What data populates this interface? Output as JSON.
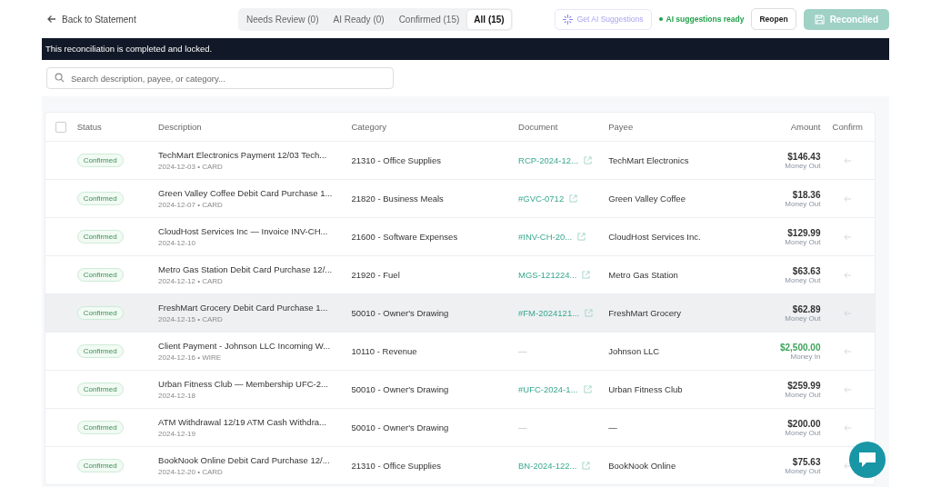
{
  "back_link": "Back to Statement",
  "tabs": [
    {
      "label": "Needs Review (0)",
      "selected": false
    },
    {
      "label": "AI Ready (0)",
      "selected": false
    },
    {
      "label": "Confirmed (15)",
      "selected": false
    },
    {
      "label": "All (15)",
      "selected": true
    }
  ],
  "ai_button": {
    "label": "Get AI Suggestions",
    "disabled": true
  },
  "ai_status": {
    "label": "AI suggestions ready",
    "color": "#22a04b"
  },
  "reopen_button": "Reopen",
  "reconciled_button": {
    "label": "Reconciled",
    "disabled": true
  },
  "banner": "This reconciliation is completed and locked.",
  "search": {
    "placeholder": "Search description, payee, or category..."
  },
  "table": {
    "select_all": {
      "checked": false
    },
    "columns": [
      "Status",
      "Description",
      "Category",
      "Document",
      "Payee",
      "Amount",
      "Confirm"
    ],
    "rows": [
      {
        "status": "Confirmed",
        "description": "TechMart Electronics Payment 12/03 Tech...",
        "meta": "2024-12-03 • CARD",
        "category": "21310 - Office Supplies",
        "document": "RCP-2024-12...",
        "document_linked": true,
        "payee": "TechMart Electronics",
        "amount": "$146.43",
        "direction": "Money Out",
        "kind": "out",
        "highlighted": false
      },
      {
        "status": "Confirmed",
        "description": "Green Valley Coffee Debit Card Purchase 1...",
        "meta": "2024-12-07 • CARD",
        "category": "21820 - Business Meals",
        "document": "#GVC-0712",
        "document_linked": true,
        "payee": "Green Valley Coffee",
        "amount": "$18.36",
        "direction": "Money Out",
        "kind": "out",
        "highlighted": false
      },
      {
        "status": "Confirmed",
        "description": "CloudHost Services Inc — Invoice INV-CH...",
        "meta": "2024-12-10",
        "category": "21600 - Software Expenses",
        "document": "#INV-CH-20...",
        "document_linked": true,
        "payee": "CloudHost Services Inc.",
        "amount": "$129.99",
        "direction": "Money Out",
        "kind": "out",
        "highlighted": false
      },
      {
        "status": "Confirmed",
        "description": "Metro Gas Station Debit Card Purchase 12/...",
        "meta": "2024-12-12 • CARD",
        "category": "21920 - Fuel",
        "document": "MGS-121224...",
        "document_linked": true,
        "payee": "Metro Gas Station",
        "amount": "$63.63",
        "direction": "Money Out",
        "kind": "out",
        "highlighted": false
      },
      {
        "status": "Confirmed",
        "description": "FreshMart Grocery Debit Card Purchase 1...",
        "meta": "2024-12-15 • CARD",
        "category": "50010 - Owner's Drawing",
        "document": "#FM-2024121...",
        "document_linked": true,
        "payee": "FreshMart Grocery",
        "amount": "$62.89",
        "direction": "Money Out",
        "kind": "out",
        "highlighted": true
      },
      {
        "status": "Confirmed",
        "description": "Client Payment - Johnson LLC Incoming W...",
        "meta": "2024-12-16 • WIRE",
        "category": "10110 - Revenue",
        "document": "—",
        "document_linked": false,
        "payee": "Johnson LLC",
        "amount": "$2,500.00",
        "direction": "Money In",
        "kind": "in",
        "highlighted": false
      },
      {
        "status": "Confirmed",
        "description": "Urban Fitness Club — Membership UFC-2...",
        "meta": "2024-12-18",
        "category": "50010 - Owner's Drawing",
        "document": "#UFC-2024-1...",
        "document_linked": true,
        "payee": "Urban Fitness Club",
        "amount": "$259.99",
        "direction": "Money Out",
        "kind": "out",
        "highlighted": false
      },
      {
        "status": "Confirmed",
        "description": "ATM Withdrawal 12/19 ATM Cash Withdra...",
        "meta": "2024-12-19",
        "category": "50010 - Owner's Drawing",
        "document": "—",
        "document_linked": false,
        "payee": "—",
        "amount": "$200.00",
        "direction": "Money Out",
        "kind": "out",
        "highlighted": false
      },
      {
        "status": "Confirmed",
        "description": "BookNook Online Debit Card Purchase 12/...",
        "meta": "2024-12-20 • CARD",
        "category": "21310 - Office Supplies",
        "document": "BN-2024-122...",
        "document_linked": true,
        "payee": "BookNook Online",
        "amount": "$75.63",
        "direction": "Money Out",
        "kind": "out",
        "highlighted": false
      }
    ]
  }
}
